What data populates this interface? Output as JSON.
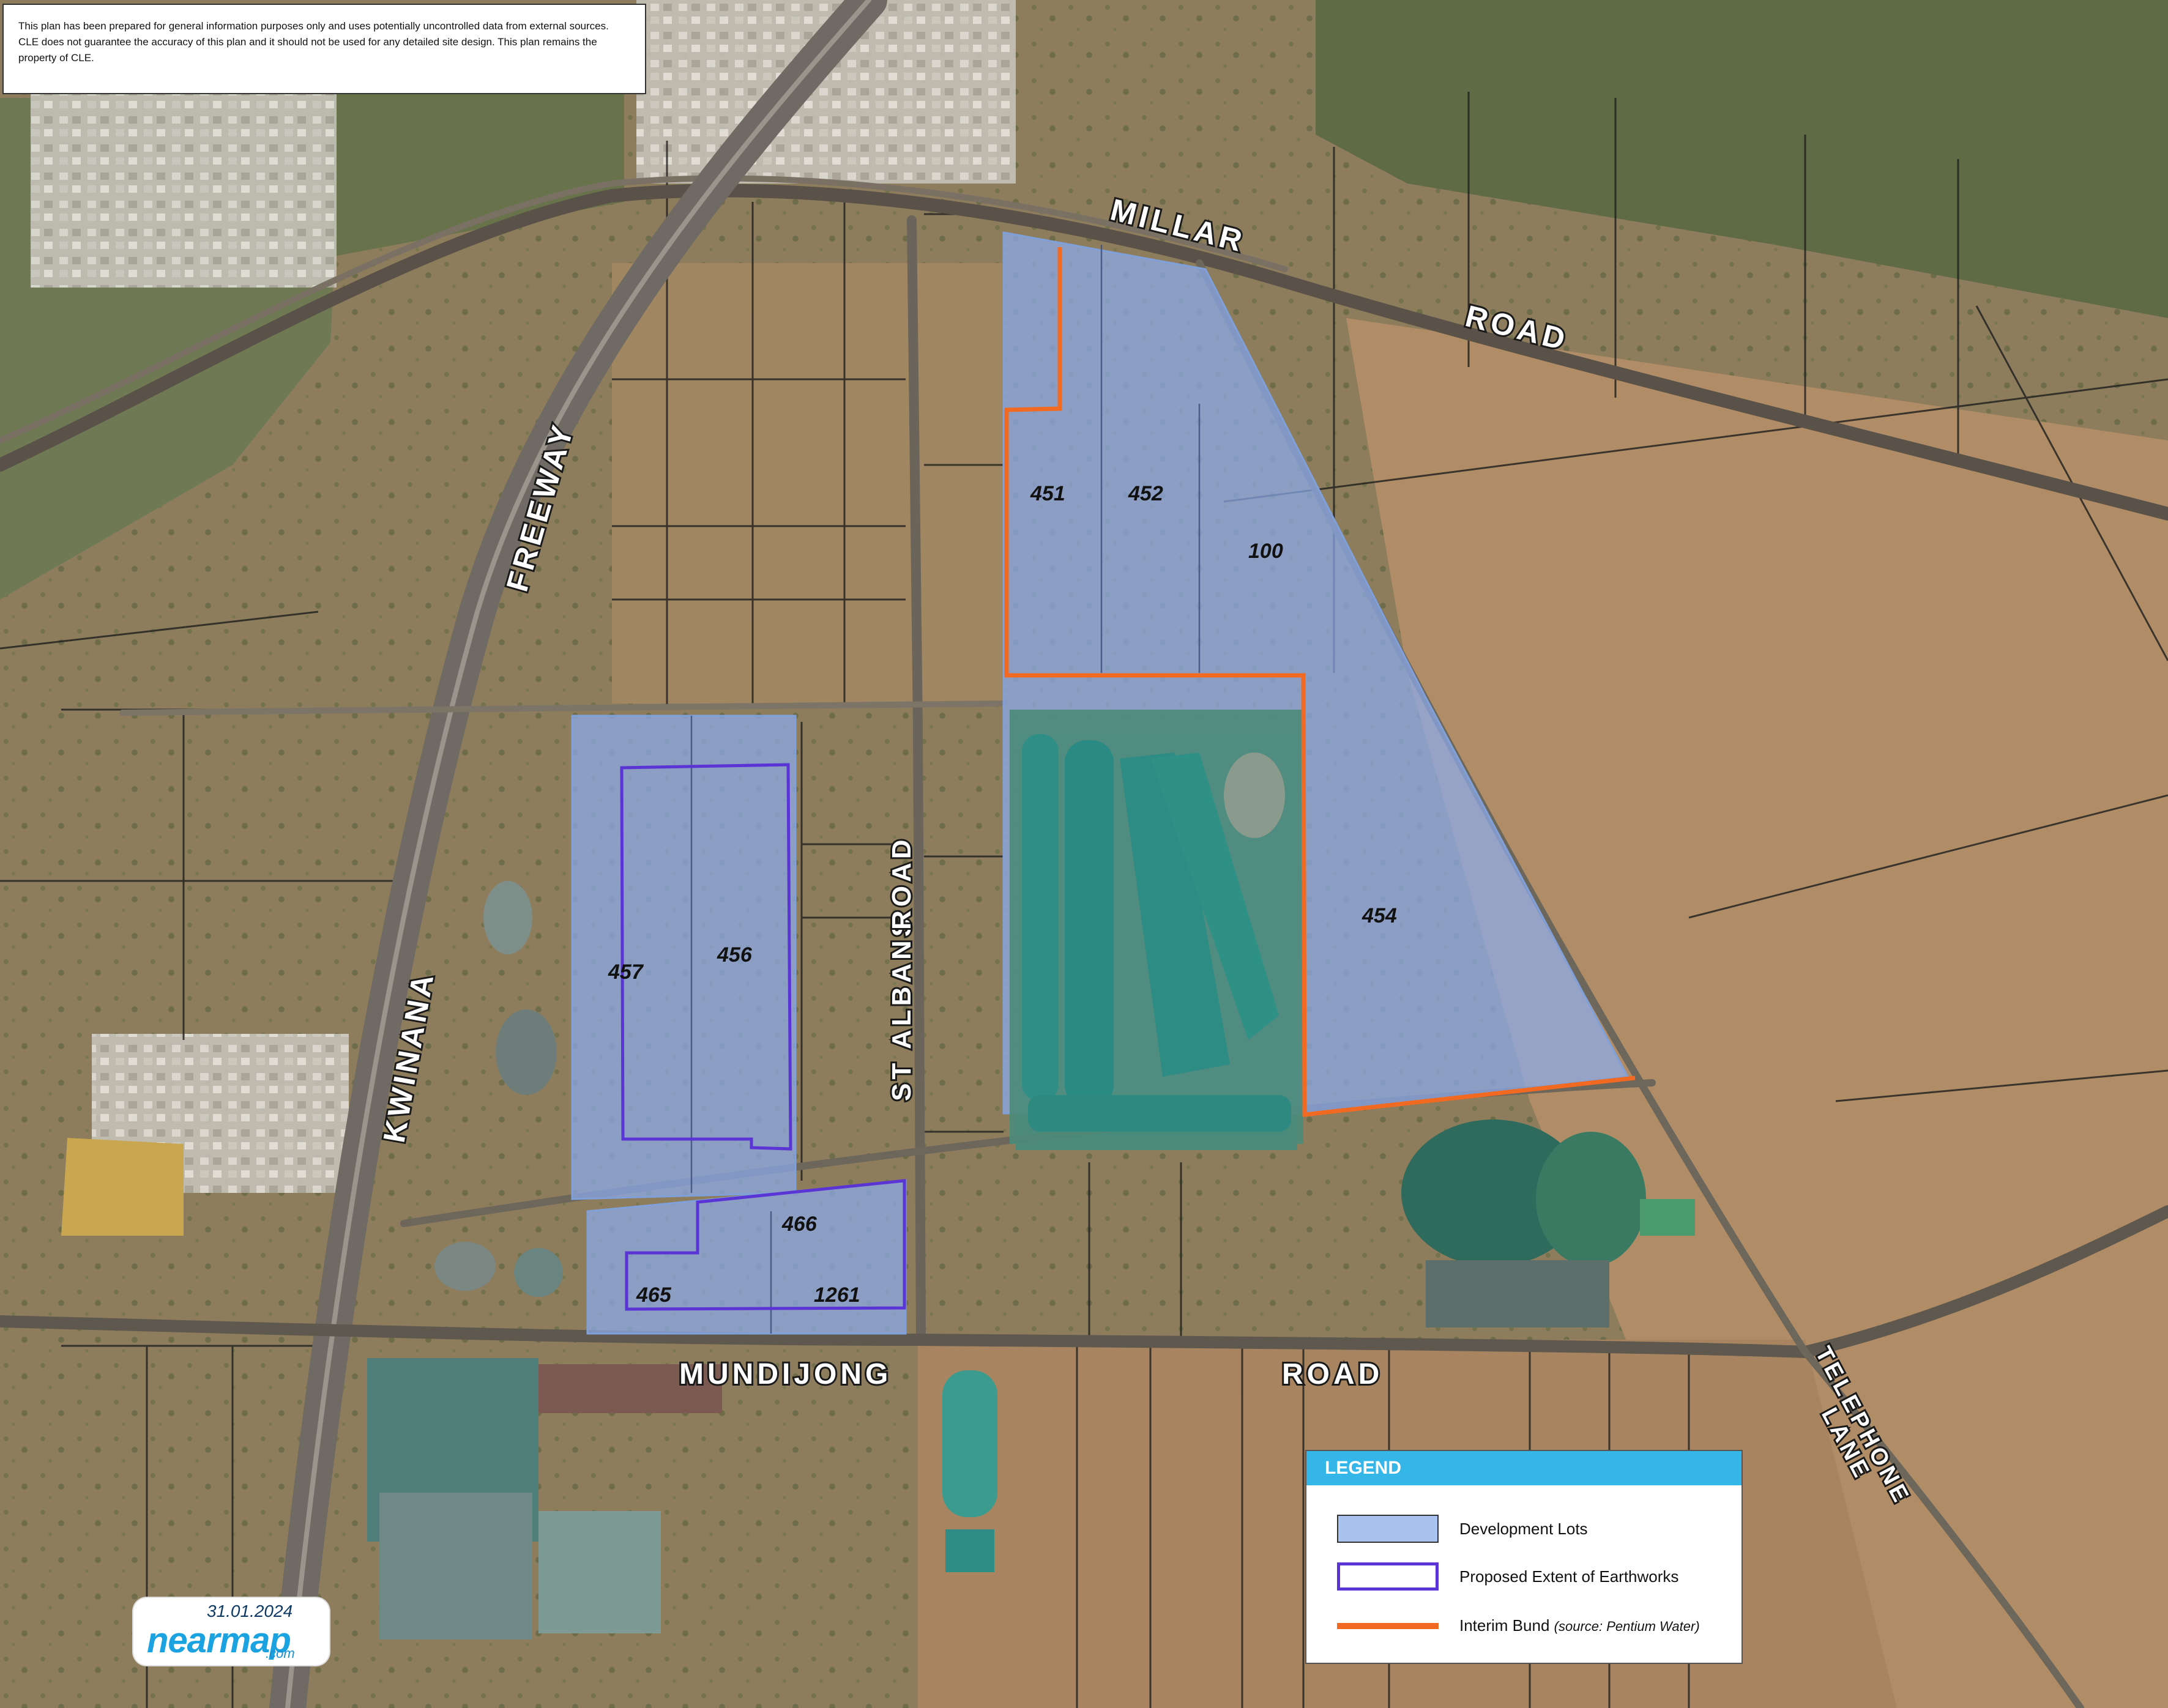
{
  "disclaimer": "This plan has been prepared for general information purposes only and uses potentially uncontrolled data from external sources. CLE does not guarantee the accuracy of this plan and it should not be used for any detailed site design. This plan remains the property of CLE.",
  "roads": {
    "millar": "MILLAR",
    "millar_road": "ROAD",
    "freeway": "FREEWAY",
    "kwinana": "KWINANA",
    "st_albans": "ST ALBANS",
    "st_albans_road": "ROAD",
    "mundijong": "MUNDIJONG",
    "mundijong_road": "ROAD",
    "telephone": "TELEPHONE",
    "lane": "LANE"
  },
  "lots": {
    "l451": "451",
    "l452": "452",
    "l100": "100",
    "l454": "454",
    "l457": "457",
    "l456": "456",
    "l466": "466",
    "l465": "465",
    "l1261": "1261"
  },
  "legend": {
    "title": "LEGEND",
    "development_lots": "Development Lots",
    "earthworks": "Proposed Extent of Earthworks",
    "bund": "Interim Bund",
    "bund_source": "(source: Pentium Water)"
  },
  "logo": {
    "date": "31.01.2024",
    "brand": "nearmap",
    "domain": ".com"
  },
  "colors": {
    "development_lots_fill": "#a9c2ef",
    "earthworks_outline": "#5b34d6",
    "interim_bund": "#f26a21",
    "legend_header": "#35b6e8"
  }
}
